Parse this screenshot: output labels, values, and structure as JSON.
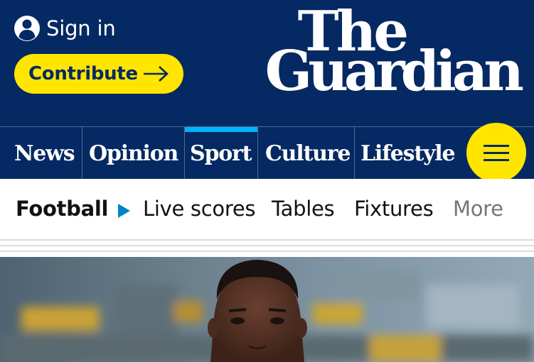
{
  "header": {
    "sign_in_label": "Sign in",
    "contribute_label": "Contribute",
    "logo_line1": "The",
    "logo_line2": "Guardian"
  },
  "pillars": [
    {
      "label": "News",
      "active": false
    },
    {
      "label": "Opinion",
      "active": false
    },
    {
      "label": "Sport",
      "active": true
    },
    {
      "label": "Culture",
      "active": false
    },
    {
      "label": "Lifestyle",
      "active": false
    }
  ],
  "subnav": {
    "section": "Football",
    "items": [
      "Live scores",
      "Tables",
      "Fixtures"
    ],
    "more_label": "More"
  },
  "icons": {
    "sign_in": "user-icon",
    "contribute": "arrow-right-icon",
    "menu": "hamburger-menu-icon",
    "subnav_marker": "triangle-right-icon"
  },
  "colors": {
    "brand_blue": "#052962",
    "brand_yellow": "#ffe500",
    "sport_accent": "#00b2ff",
    "subnav_marker": "#0084c6",
    "divider": "#506991"
  }
}
